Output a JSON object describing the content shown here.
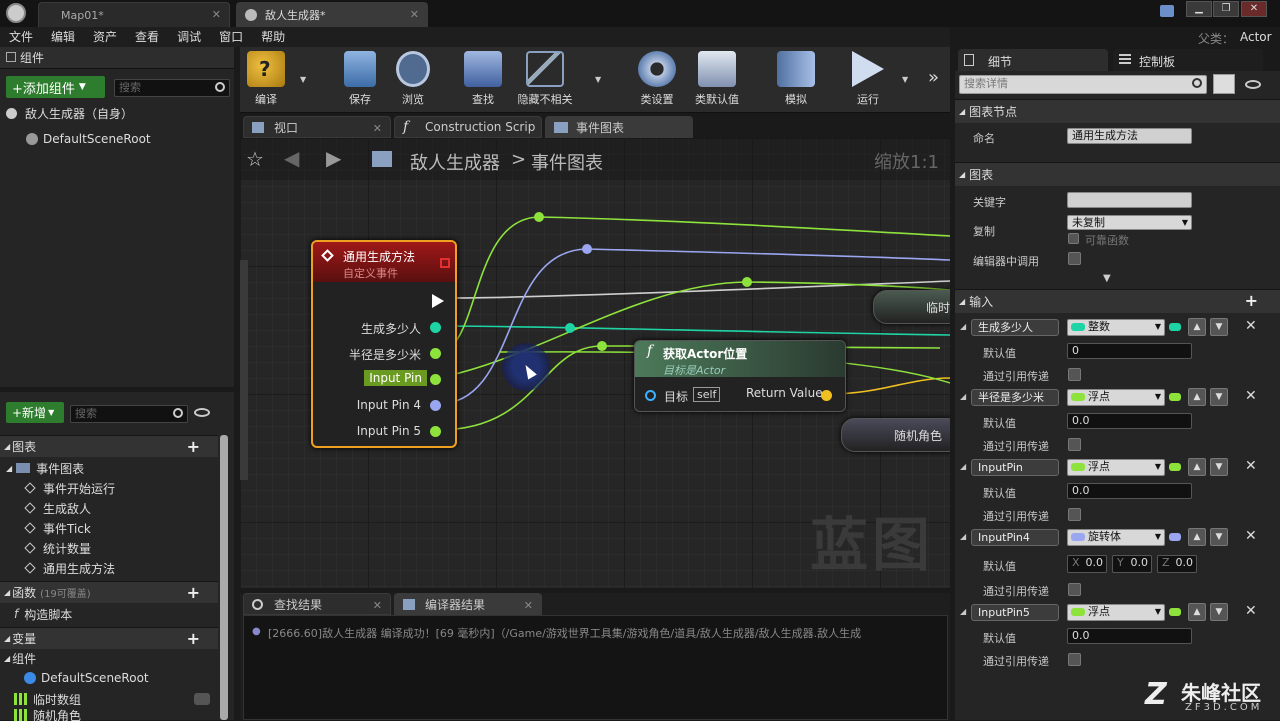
{
  "window": {
    "tabs": [
      {
        "label": "Map01*"
      },
      {
        "label": "敌人生成器*"
      }
    ],
    "parent_label": "父类：",
    "parent_value": "Actor"
  },
  "menu": [
    "文件",
    "编辑",
    "资产",
    "查看",
    "调试",
    "窗口",
    "帮助"
  ],
  "components": {
    "header": "组件",
    "add_button": "+添加组件",
    "search_placeholder": "搜索",
    "root": "敌人生成器（自身）",
    "child": "DefaultSceneRoot"
  },
  "mybp": {
    "new_button": "+新增",
    "search_placeholder": "搜索",
    "graphs_header": "图表",
    "event_graph": "事件图表",
    "events": [
      "事件开始运行",
      "生成敌人",
      "事件Tick",
      "统计数量",
      "通用生成方法"
    ],
    "functions_header": "函数",
    "functions_note": "(19可覆盖)",
    "construction": "构造脚本",
    "variables_header": "变量",
    "components_group": "组件",
    "var_scene_root": "DefaultSceneRoot",
    "var_temp_array": "临时数组",
    "var_random": "随机角色"
  },
  "toolbar": {
    "items": [
      "编译",
      "保存",
      "浏览",
      "查找",
      "隐藏不相关",
      "类设置",
      "类默认值",
      "模拟",
      "运行"
    ]
  },
  "graph_tabs": [
    "视口",
    "Construction Scrip",
    "事件图表"
  ],
  "graph": {
    "breadcrumb_root": "敌人生成器",
    "breadcrumb_sep": ">",
    "breadcrumb_current": "事件图表",
    "zoom": "缩放1:1",
    "watermark": "蓝图",
    "event_node": {
      "title": "通用生成方法",
      "subtitle": "自定义事件",
      "pins": [
        "生成多少人",
        "半径是多少米",
        "Input Pin",
        "Input Pin 4",
        "Input Pin 5"
      ]
    },
    "func_node": {
      "title": "获取Actor位置",
      "subtitle": "目标是Actor",
      "target_label": "目标",
      "target_value": "self",
      "return_label": "Return Value"
    },
    "partial_node_1": "临时",
    "partial_node_2": "随机角色"
  },
  "details": {
    "tab_details": "细节",
    "tab_palette": "控制板",
    "search_placeholder": "搜索详情",
    "graph_node_header": "图表节点",
    "name_label": "命名",
    "name_value": "通用生成方法",
    "graph_header": "图表",
    "keyword_label": "关键字",
    "keyword_value": "",
    "replicate_label": "复制",
    "replicate_value": "未复制",
    "reliable_label": "可靠函数",
    "editor_call_label": "编辑器中调用",
    "inputs_header": "输入",
    "default_label": "默认值",
    "by_ref_label": "通过引用传递",
    "inputs": [
      {
        "name": "生成多少人",
        "type": "整数",
        "default": "0",
        "color": "#1fd4a4"
      },
      {
        "name": "半径是多少米",
        "type": "浮点",
        "default": "0.0",
        "color": "#8ee23c"
      },
      {
        "name": "InputPin",
        "type": "浮点",
        "default": "0.0",
        "color": "#8ee23c"
      },
      {
        "name": "InputPin4",
        "type": "旋转体",
        "x": "0.0",
        "y": "0.0",
        "z": "0.0",
        "color": "#9aa6f0"
      },
      {
        "name": "InputPin5",
        "type": "浮点",
        "default": "0.0",
        "color": "#8ee23c"
      }
    ],
    "xyz": [
      "X",
      "Y",
      "Z"
    ]
  },
  "output": {
    "tab_find": "查找结果",
    "tab_compiler": "编译器结果",
    "message": "[2666.60]敌人生成器 编译成功！[69 毫秒内]（/Game/游戏世界工具集/游戏角色/道具/敌人生成器/敌人生成器.敌人生成"
  },
  "brand": {
    "name": "朱峰社区",
    "url": "ZF3D.COM"
  },
  "colors": {
    "float": "#8ee23c",
    "int": "#1fd4a4",
    "rotator": "#9aa6f0",
    "event_header": "#8a1a1a",
    "func_header": "#3e5e48"
  }
}
